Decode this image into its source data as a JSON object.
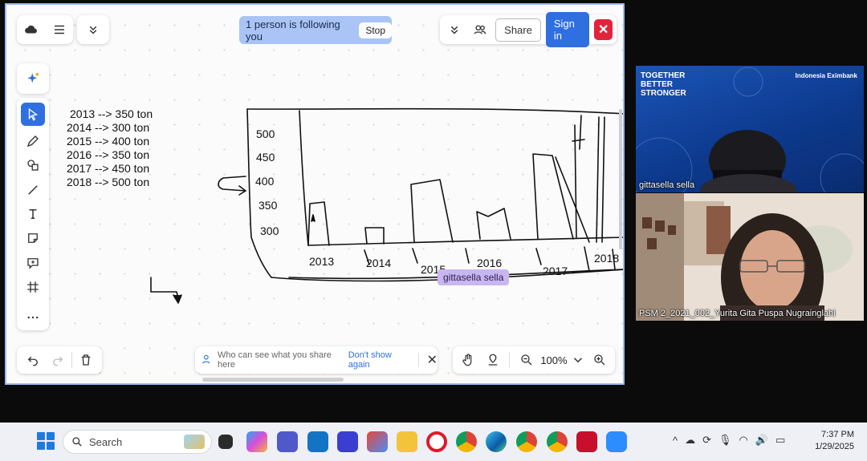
{
  "banner": {
    "following_text": "1 person is following you",
    "stop_label": "Stop"
  },
  "header": {
    "share_label": "Share",
    "signin_label": "Sign in",
    "close_label": "✕"
  },
  "notes": [
    "2013 --> 350 ton",
    "2014 --> 300 ton",
    "2015 --> 400 ton",
    "2016 --> 350 ton",
    "2017 --> 450 ton",
    "2018 --> 500 ton"
  ],
  "sketch": {
    "y_labels": [
      "500",
      "450",
      "400",
      "350",
      "300"
    ],
    "x_labels": [
      "2013",
      "2014",
      "2015",
      "2016",
      "2017",
      "2018"
    ]
  },
  "collaborator_tag": "gittasella sella",
  "share_hint": {
    "text": "Who can see what you share here",
    "link": "Don't show again"
  },
  "zoom": {
    "level": "100%"
  },
  "video": {
    "tile1": {
      "title": "TOGETHER\nBETTER\nSTRONGER",
      "brand": "Indonesia Eximbank",
      "name": "gittasella sella"
    },
    "tile2": {
      "name": "PSM 2_2021_002_Yurita Gita Puspa Nugrainglahi"
    }
  },
  "taskbar": {
    "search_placeholder": "Search",
    "time": "7:37 PM",
    "date": "1/29/2025"
  },
  "colors": {
    "accent": "#2f6fe0",
    "danger": "#e0243c",
    "banner": "#a9c4f5",
    "tag": "#c9b6f0"
  },
  "icons": [
    "cloud-icon",
    "menu-icon",
    "chevrons-down-icon",
    "users-icon",
    "sparkle-icon",
    "cursor-icon",
    "pencil-icon",
    "shapes-icon",
    "line-icon",
    "text-icon",
    "sticky-note-icon",
    "comment-icon",
    "frame-icon",
    "more-icon",
    "undo-icon",
    "redo-icon",
    "trash-icon",
    "hand-icon",
    "pin-icon",
    "zoom-out-icon",
    "zoom-in-icon"
  ]
}
